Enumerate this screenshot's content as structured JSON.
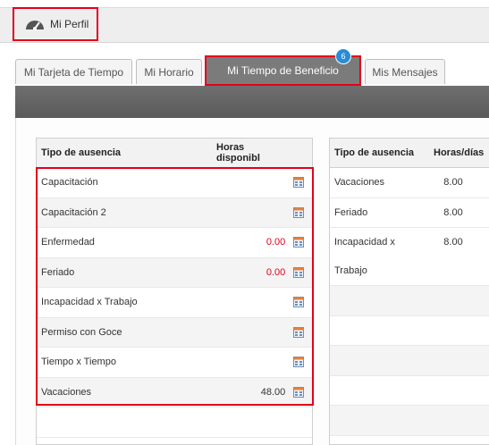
{
  "profile_button": {
    "label": "Mi Perfil",
    "icon": "speedometer-icon"
  },
  "tabs": [
    {
      "label": "Mi Tarjeta de Tiempo"
    },
    {
      "label": "Mi Horario"
    },
    {
      "label": "Mi Tiempo de Beneficio",
      "active": true,
      "badge": "6"
    },
    {
      "label": "Mis Mensajes"
    }
  ],
  "left_table": {
    "headers": [
      "Tipo de ausencia",
      "Horas disponibl"
    ],
    "rows": [
      {
        "type": "Capacitación",
        "hours": ""
      },
      {
        "type": "Capacitación 2",
        "hours": ""
      },
      {
        "type": "Enfermedad",
        "hours": "0.00"
      },
      {
        "type": "Feriado",
        "hours": "0.00"
      },
      {
        "type": "Incapacidad x Trabajo",
        "hours": ""
      },
      {
        "type": "Permiso con Goce",
        "hours": ""
      },
      {
        "type": "Tiempo x Tiempo",
        "hours": ""
      },
      {
        "type": "Vacaciones",
        "hours": "48.00"
      }
    ]
  },
  "right_table": {
    "headers": [
      "Tipo de ausencia",
      "Horas/días"
    ],
    "rows": [
      {
        "type": "Vacaciones",
        "value": "8.00"
      },
      {
        "type": "Feriado",
        "value": "8.00"
      },
      {
        "type": "Incapacidad x",
        "value": "8.00"
      },
      {
        "type": "Trabajo",
        "value": ""
      }
    ]
  },
  "colors": {
    "highlight": "#e3001b",
    "active_tab": "#7b7b7b",
    "badge": "#2b8cd6"
  }
}
